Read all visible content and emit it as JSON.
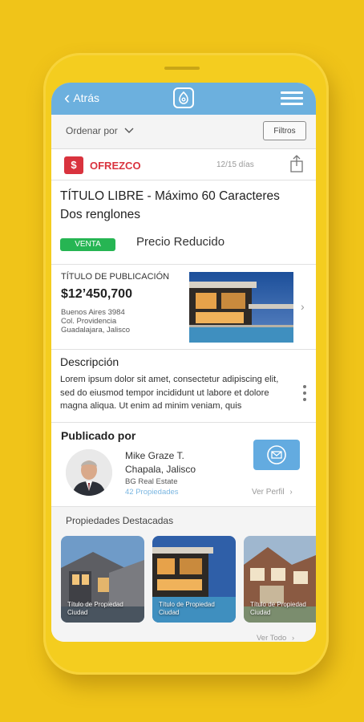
{
  "header": {
    "back_label": "Atrás"
  },
  "sortbar": {
    "sort_label": "Ordenar por",
    "filter_label": "Filtros"
  },
  "offer": {
    "name": "OFREZCO",
    "days": "12/15 días"
  },
  "listing": {
    "title_line1": "TÍTULO LIBRE - Máximo 60 Caracteres",
    "title_line2": "Dos renglones",
    "badge": "VENTA",
    "price_note": "Precio Reducido"
  },
  "publication": {
    "title": "TÍTULO DE PUBLICACIÓN",
    "price": "$12’450,700",
    "address_line1": "Buenos Aires 3984",
    "address_line2": "Col. Providencia",
    "address_line3": "Guadalajara, Jalisco"
  },
  "description": {
    "heading": "Descripción",
    "text": "Lorem ipsum dolor sit amet, consectetur adipiscing elit, sed do eiusmod tempor incididunt ut labore et dolore magna aliqua. Ut enim ad minim veniam, quis"
  },
  "publisher": {
    "heading": "Publicado por",
    "name": "Mike Graze T.",
    "city": "Chapala, Jalisco",
    "company": "BG Real Estate",
    "properties": "42 Propiedades",
    "profile_link": "Ver Perfil"
  },
  "featured": {
    "heading": "Propiedades Destacadas",
    "items": [
      {
        "title": "Título de Propiedad",
        "city": "Ciudad"
      },
      {
        "title": "Título de Propiedad",
        "city": "Ciudad"
      },
      {
        "title": "Título de Propiedad",
        "city": "Ciudad"
      }
    ],
    "see_all": "Ver Todo"
  },
  "colors": {
    "background": "#f0c419",
    "header": "#6cb0de",
    "brand_red": "#d9333e",
    "sale_green": "#26b553",
    "link_blue": "#7ab6e1"
  },
  "icons": [
    "chevron-left-icon",
    "home-logo-icon",
    "hamburger-menu-icon",
    "chevron-down-icon",
    "share-icon",
    "more-vertical-icon",
    "mail-icon",
    "chevron-right-icon"
  ]
}
